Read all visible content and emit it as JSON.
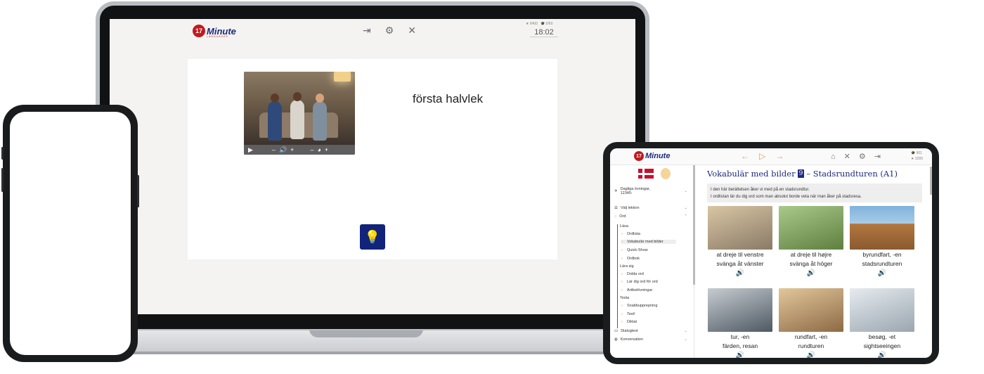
{
  "laptop": {
    "logo_num": "17",
    "logo_word": "Minute",
    "logo_sub": "LANGUAGES",
    "stats": [
      "6400",
      "0/60"
    ],
    "clock": "18:02",
    "word": "första halvlek",
    "video_controls": [
      "▶",
      "–",
      "🔊",
      "+",
      "–",
      "◕",
      "+"
    ],
    "hint_icon": "lightbulb-icon"
  },
  "tablet": {
    "logo_num": "17",
    "logo_word": "Minute",
    "stats": [
      "901",
      "3289"
    ],
    "title_prefix": "Vokabulär med bilder",
    "title_num": "9",
    "title_suffix": "– Stadsrundturen (A1)",
    "desc_line1": "I den här berättelsen åker vi med på en stadsrundtur.",
    "desc_line2": "I ordlistan lär du dig ord som man absolut borde veta när man åker på stadsresa.",
    "sidebar": {
      "daily_label_1": "Dagliga övningar,",
      "daily_label_2": "12345:",
      "choose_lesson": "Välj lektion",
      "words": "Ord",
      "read": "Läsa",
      "read_items": [
        "Ordlista",
        "Vokabulär med bilder",
        "Quick-Show",
        "Ordbok"
      ],
      "learn": "Lära sig",
      "learn_items": [
        "Dolda ord",
        "Lär dig ord för ord",
        "Artikelövningar"
      ],
      "test": "Testa",
      "test_items": [
        "Snabbupprepning",
        "Test!",
        "Diktat"
      ],
      "dialog": "Dialogtext",
      "conversation": "Konversation"
    },
    "tiles": [
      {
        "da": "at dreje til venstre",
        "sv": "svänga åt vänster",
        "color": "#9b8a73"
      },
      {
        "da": "at dreje til højre",
        "sv": "svänga åt höger",
        "color": "#8db26a"
      },
      {
        "da": "byrundfart, -en",
        "sv": "stadsrundturen",
        "color": "#c98a4e"
      },
      {
        "da": "tur, -en",
        "sv": "färden, resan",
        "color": "#6f7f8c"
      },
      {
        "da": "rundfart, -en",
        "sv": "rundturen",
        "color": "#b49a6c"
      },
      {
        "da": "besøg, -et",
        "sv": "sightseeingen",
        "color": "#a9b4bd"
      }
    ]
  }
}
